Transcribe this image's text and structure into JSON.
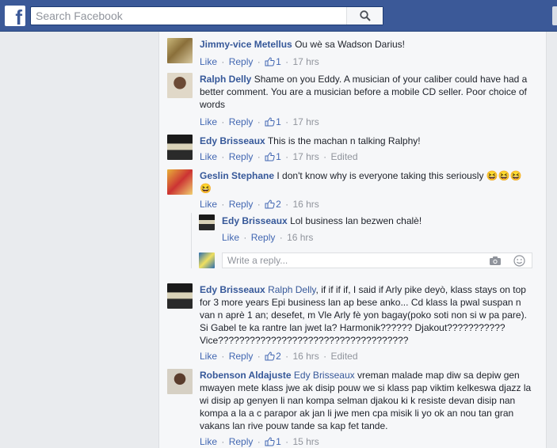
{
  "header": {
    "logo": "f",
    "search_placeholder": "Search Facebook",
    "search_icon": "search-icon"
  },
  "actions": {
    "like": "Like",
    "reply": "Reply",
    "dot": "·"
  },
  "comments": [
    {
      "author": "Jimmy-vice Metellus",
      "tag": "",
      "text": "Ou wè sa Wadson Darius!",
      "likes": "1",
      "time": "17 hrs",
      "edited": ""
    },
    {
      "author": "Ralph Delly",
      "tag": "",
      "text": "Shame on you Eddy. A musician of your caliber could have had a better comment. You are a musician before a mobile CD seller. Poor choice of words",
      "likes": "1",
      "time": "17 hrs",
      "edited": ""
    },
    {
      "author": "Edy Brisseaux",
      "tag": "",
      "text": "This is the machan n talking Ralphy!",
      "likes": "1",
      "time": "17 hrs",
      "edited": "Edited"
    },
    {
      "author": "Geslin Stephane",
      "tag": "",
      "text": "I don't know why is everyone taking this seriously",
      "emoji": "😆😆😆😆",
      "likes": "2",
      "time": "16 hrs",
      "edited": ""
    },
    {
      "author": "Edy Brisseaux",
      "tag": "Ralph Delly",
      "text": ", if if if if, I said if Arly pike deyò, klass stays on top for 3 more years Epi business lan ap bese anko... Cd klass la pwal suspan n van n aprè 1 an; desefet, m Vle Arly fè yon bagay(poko soti non si w pa pare). Si Gabel te ka rantre lan jwet la? Harmonik?????? Djakout??????????? Vice????????????????????????????????????",
      "likes": "2",
      "time": "16 hrs",
      "edited": "Edited"
    },
    {
      "author": "Robenson Aldajuste",
      "tag": "Edy Brisseaux",
      "text": " vreman malade map diw sa depiw gen mwayen mete klass jwe ak disip pouw we si klass pap viktim kelkeswa djazz la wi disip ap genyen li nan kompa selman djakou ki k resiste devan disip nan kompa a la a c parapor ak jan li jwe men cpa misik li yo ok an nou tan gran vakans lan rive pouw tande sa kap fet tande.",
      "likes": "1",
      "time": "15 hrs",
      "edited": ""
    }
  ],
  "reply": {
    "author": "Edy Brisseaux",
    "text": "Lol business lan bezwen chalè!",
    "time": "16 hrs",
    "placeholder": "Write a reply..."
  }
}
